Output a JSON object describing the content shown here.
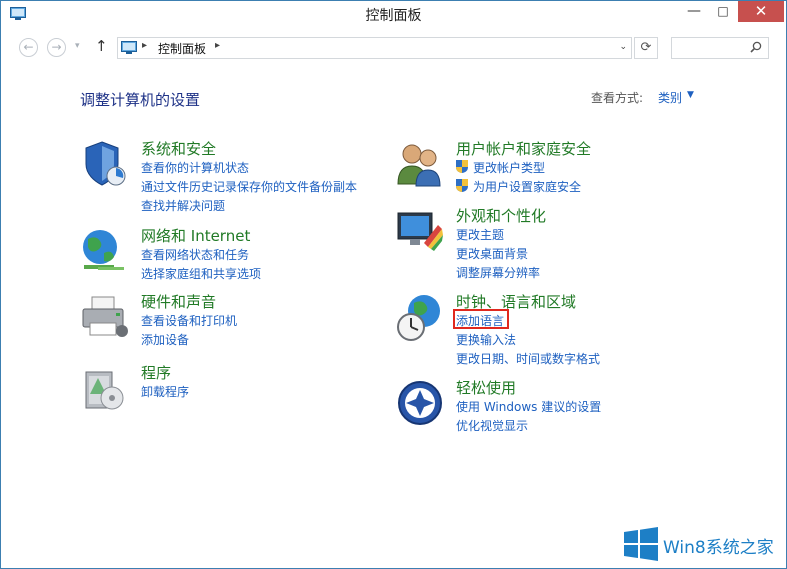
{
  "window": {
    "title": "控制面板",
    "minimize_glyph": "—",
    "maximize_glyph": "□",
    "close_glyph": "✕"
  },
  "nav": {
    "back_glyph": "←",
    "forward_glyph": "→",
    "recent_glyph": "▾",
    "up_glyph": "↑",
    "address_separator": "▸",
    "address_path": "控制面板",
    "address_dropdown_glyph": "⌄",
    "refresh_glyph": "⟳",
    "search_placeholder": ""
  },
  "header": {
    "title": "调整计算机的设置",
    "view_by_label": "查看方式:",
    "view_by_value": "类别",
    "view_by_caret": "▼"
  },
  "categories": [
    {
      "title": "系统和安全",
      "icon": "system-security-shield-icon",
      "links": [
        "查看你的计算机状态",
        "通过文件历史记录保存你的文件备份副本",
        "查找并解决问题"
      ]
    },
    {
      "title": "网络和 Internet",
      "icon": "network-globe-icon",
      "links": [
        "查看网络状态和任务",
        "选择家庭组和共享选项"
      ]
    },
    {
      "title": "硬件和声音",
      "icon": "printer-hardware-icon",
      "links": [
        "查看设备和打印机",
        "添加设备"
      ]
    },
    {
      "title": "程序",
      "icon": "programs-box-icon",
      "links": [
        "卸载程序"
      ]
    },
    {
      "title": "用户帐户和家庭安全",
      "icon": "user-accounts-icon",
      "links": [
        "更改帐户类型",
        "为用户设置家庭安全"
      ]
    },
    {
      "title": "外观和个性化",
      "icon": "appearance-monitor-icon",
      "links": [
        "更改主题",
        "更改桌面背景",
        "调整屏幕分辨率"
      ]
    },
    {
      "title": "时钟、语言和区域",
      "icon": "clock-globe-icon",
      "links": [
        "添加语言",
        "更换输入法",
        "更改日期、时间或数字格式"
      ]
    },
    {
      "title": "轻松使用",
      "icon": "ease-of-access-icon",
      "links": [
        "使用 Windows 建议的设置",
        "优化视觉显示"
      ]
    }
  ],
  "highlighted_link": "添加语言",
  "watermark": {
    "text": "Win8系统之家",
    "icon": "windows-logo-icon"
  },
  "colors": {
    "link": "#1e60c0",
    "category_title": "#217a26",
    "heading": "#1e3287",
    "close_button": "#c7504e",
    "highlight_box": "#e0281e",
    "watermark": "#1d7fc6"
  }
}
